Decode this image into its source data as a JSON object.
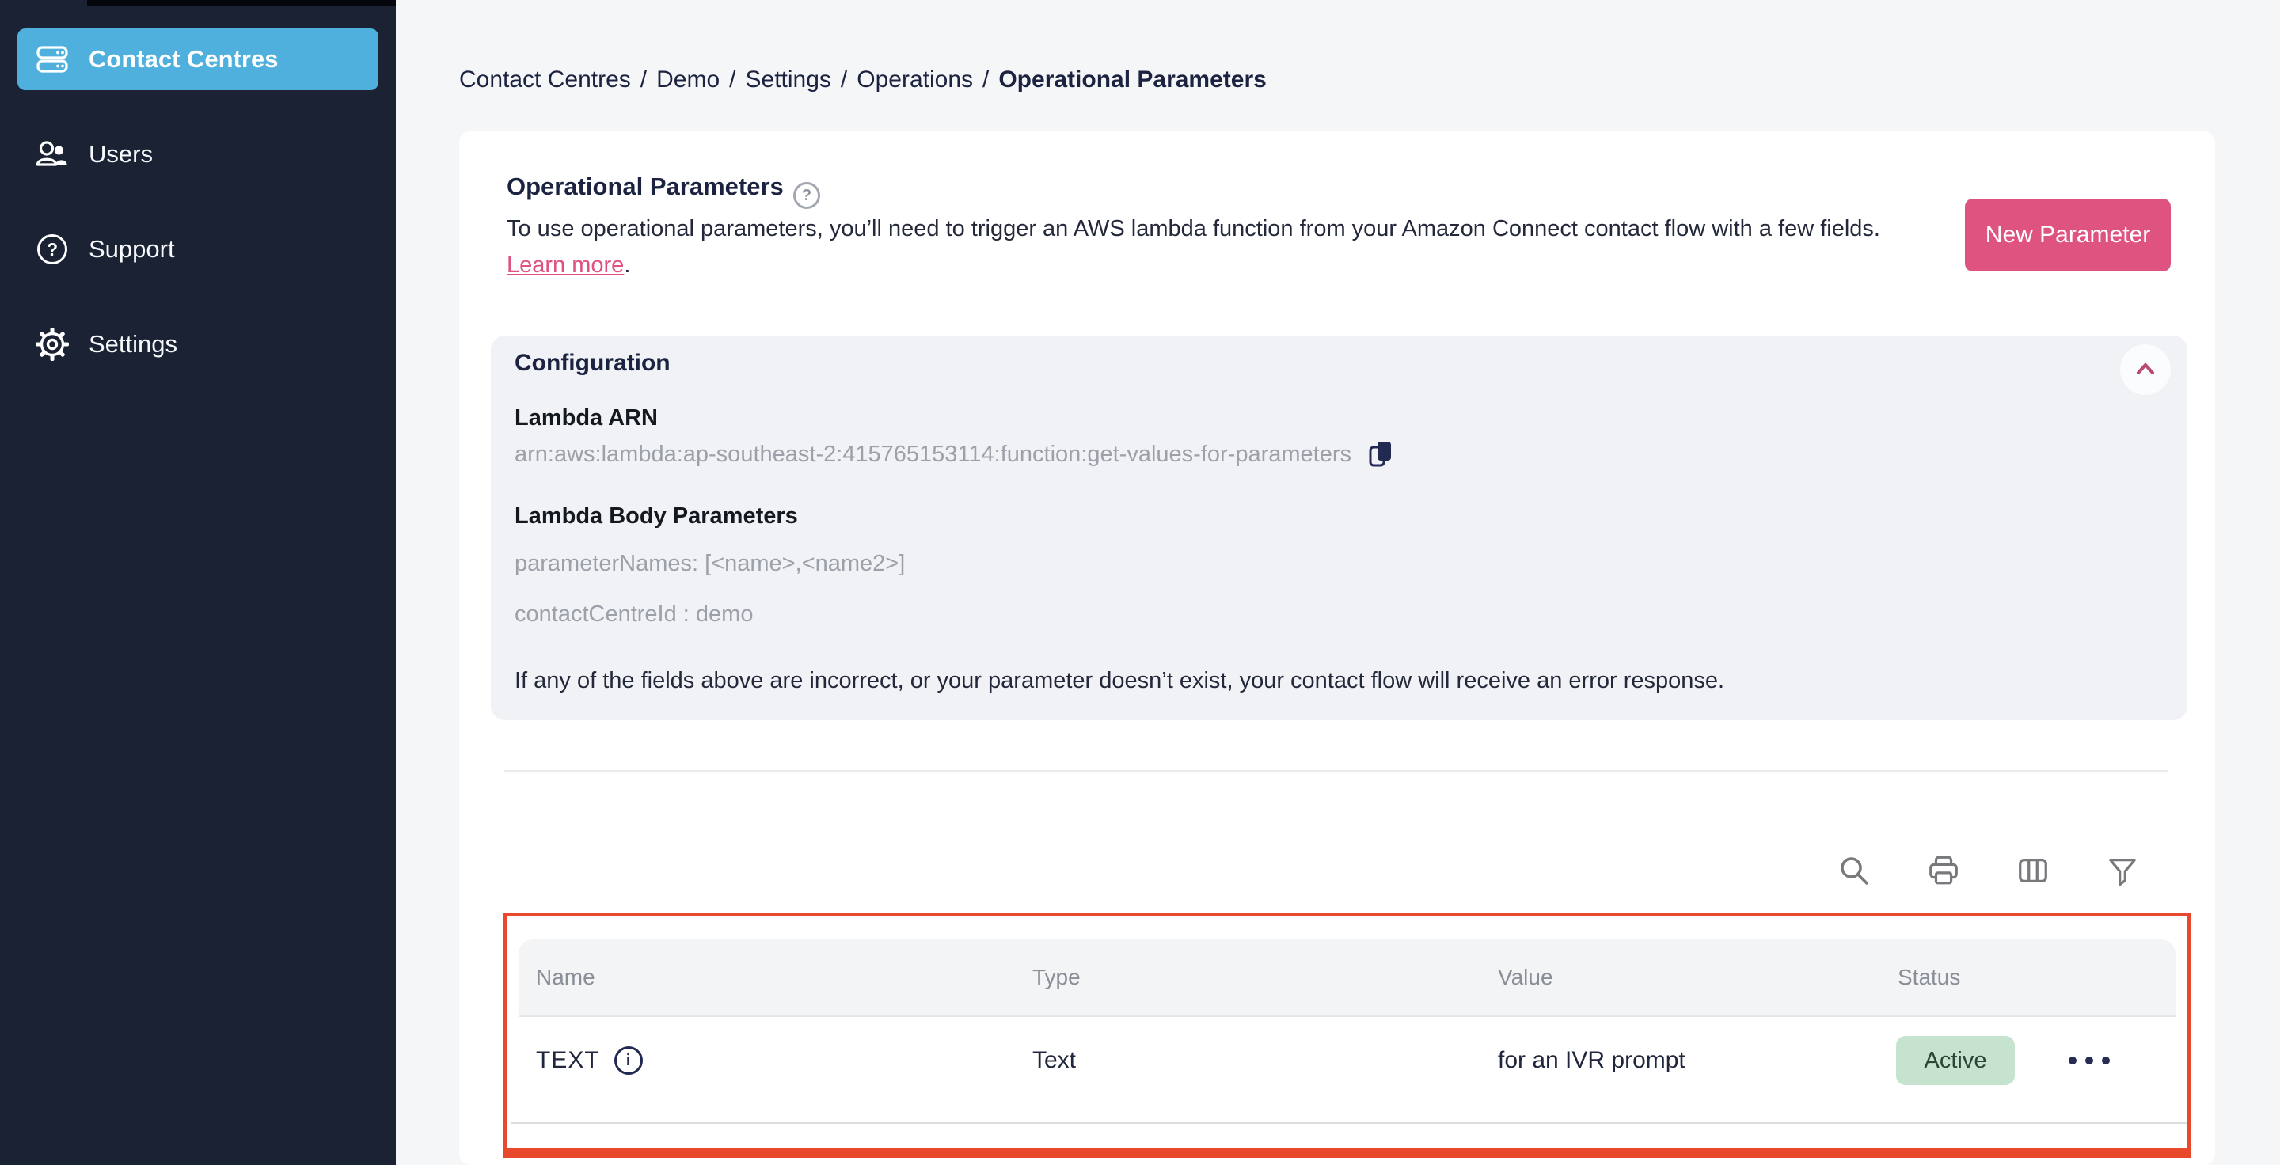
{
  "sidebar": {
    "items": [
      {
        "label": "Contact Centres",
        "icon": "server-stack-icon",
        "active": true
      },
      {
        "label": "Users",
        "icon": "users-icon",
        "active": false
      },
      {
        "label": "Support",
        "icon": "help-circle-icon",
        "active": false
      },
      {
        "label": "Settings",
        "icon": "gear-icon",
        "active": false
      }
    ]
  },
  "breadcrumb": {
    "separator": "/",
    "segments": [
      "Contact Centres",
      "Demo",
      "Settings",
      "Operations"
    ],
    "current": "Operational Parameters"
  },
  "header": {
    "title": "Operational Parameters",
    "help_glyph": "?",
    "description": "To use operational parameters, you’ll need to trigger an AWS lambda function from your Amazon Connect contact flow with a few fields. ",
    "learn_more_label": "Learn more",
    "description_suffix": ".",
    "new_parameter_label": "New Parameter"
  },
  "configuration": {
    "title": "Configuration",
    "lambda_arn_label": "Lambda ARN",
    "lambda_arn_value": "arn:aws:lambda:ap-southeast-2:415765153114:function:get-values-for-parameters",
    "body_params_label": "Lambda Body Parameters",
    "body_param_1": "parameterNames: [<name>,<name2>]",
    "body_param_2": "contactCentreId : demo",
    "warning": "If any of the fields above are incorrect, or your parameter doesn’t exist, your contact flow will receive an error response."
  },
  "table": {
    "columns": [
      "Name",
      "Type",
      "Value",
      "Status"
    ],
    "rows": [
      {
        "name": "TEXT",
        "info_glyph": "i",
        "type": "Text",
        "value": "for an IVR prompt",
        "status": "Active"
      }
    ]
  },
  "icons": {
    "toolbar": [
      "search-icon",
      "print-icon",
      "columns-icon",
      "filter-icon"
    ],
    "row_menu": "ellipsis-icon",
    "config_collapse": "chevron-up-icon",
    "arn_copy": "copy-icon"
  },
  "colors": {
    "sidebar_navy": "#1A2234",
    "active_nav_blue": "#4FB0DE",
    "accent_pink": "#DE5380",
    "link_pink": "#DF5280",
    "highlight_red": "#E8482C",
    "status_green_bg": "#C5E3CF",
    "config_gray_bg": "#F0F2F5"
  }
}
